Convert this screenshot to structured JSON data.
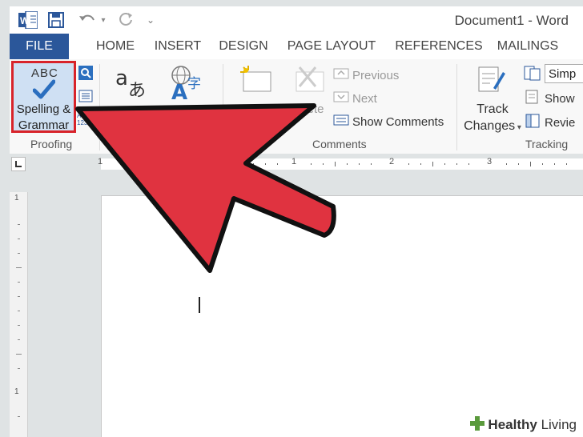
{
  "window": {
    "title": "Document1 - Word"
  },
  "qat": {
    "save_icon": "save-icon",
    "undo_icon": "undo-icon",
    "redo_icon": "redo-icon",
    "customize_icon": "customize-qat-icon"
  },
  "tabs": [
    {
      "label": "FILE"
    },
    {
      "label": "HOME"
    },
    {
      "label": "INSERT"
    },
    {
      "label": "DESIGN"
    },
    {
      "label": "PAGE LAYOUT"
    },
    {
      "label": "REFERENCES"
    },
    {
      "label": "MAILINGS"
    }
  ],
  "ribbon": {
    "proofing": {
      "group_label": "Proofing",
      "spell_abc": "ABC",
      "spell_label_line1": "Spelling &",
      "spell_label_line2": "Grammar"
    },
    "comments": {
      "group_label": "Comments",
      "delete_fragment": "elete",
      "previous": "Previous",
      "next": "Next",
      "show_comments": "Show Comments"
    },
    "tracking": {
      "group_label": "Tracking",
      "track_changes_line1": "Track",
      "track_changes_line2": "Changes",
      "simple_markup": "Simp",
      "show_markup": "Show",
      "reviewing_pane": "Revie"
    }
  },
  "ruler": {
    "marks": [
      "1",
      "1",
      "2",
      "3"
    ],
    "vmarks": [
      "1",
      "1"
    ]
  },
  "watermark": {
    "brand": "Healthy",
    "brand2": "Living"
  },
  "colors": {
    "accent": "#2b579a",
    "highlight_border": "#d8232a",
    "arrow_fill": "#e03340"
  }
}
